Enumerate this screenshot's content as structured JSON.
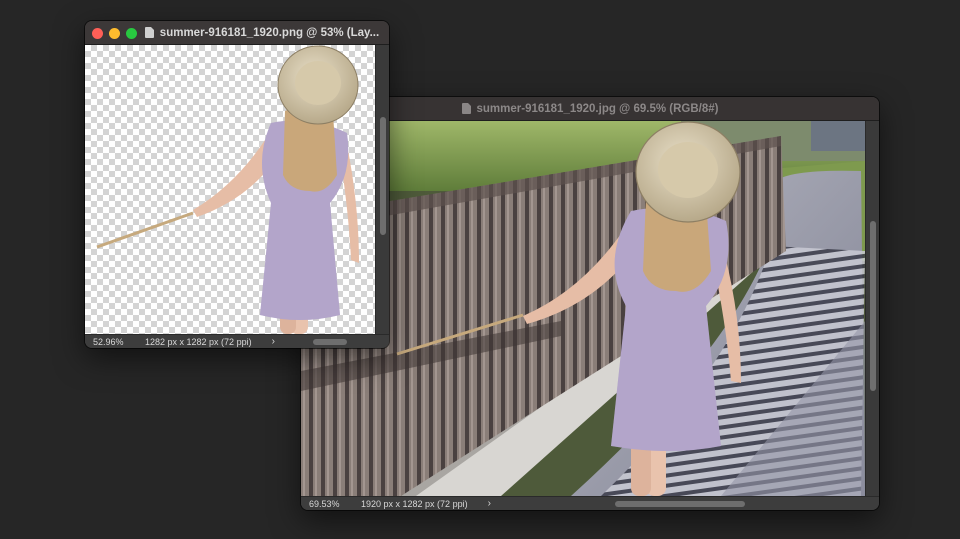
{
  "windows": {
    "png_doc": {
      "title": "summer-916181_1920.png @ 53% (Lay...",
      "zoom": "52.96%",
      "dimensions": "1282 px x 1282 px (72 ppi)",
      "arrow": "›",
      "file_icon": "document-icon",
      "scroll_position": 0.45
    },
    "jpg_doc": {
      "title": "summer-916181_1920.jpg @ 69.5% (RGB/8#)",
      "zoom": "69.53%",
      "dimensions": "1920 px x 1282 px (72 ppi)",
      "arrow": "›",
      "file_icon": "document-icon",
      "scroll_position": 0.5
    }
  },
  "colors": {
    "background": "#262626",
    "close": "#ff5f57",
    "minimize": "#febc2e",
    "zoom": "#28c840"
  }
}
